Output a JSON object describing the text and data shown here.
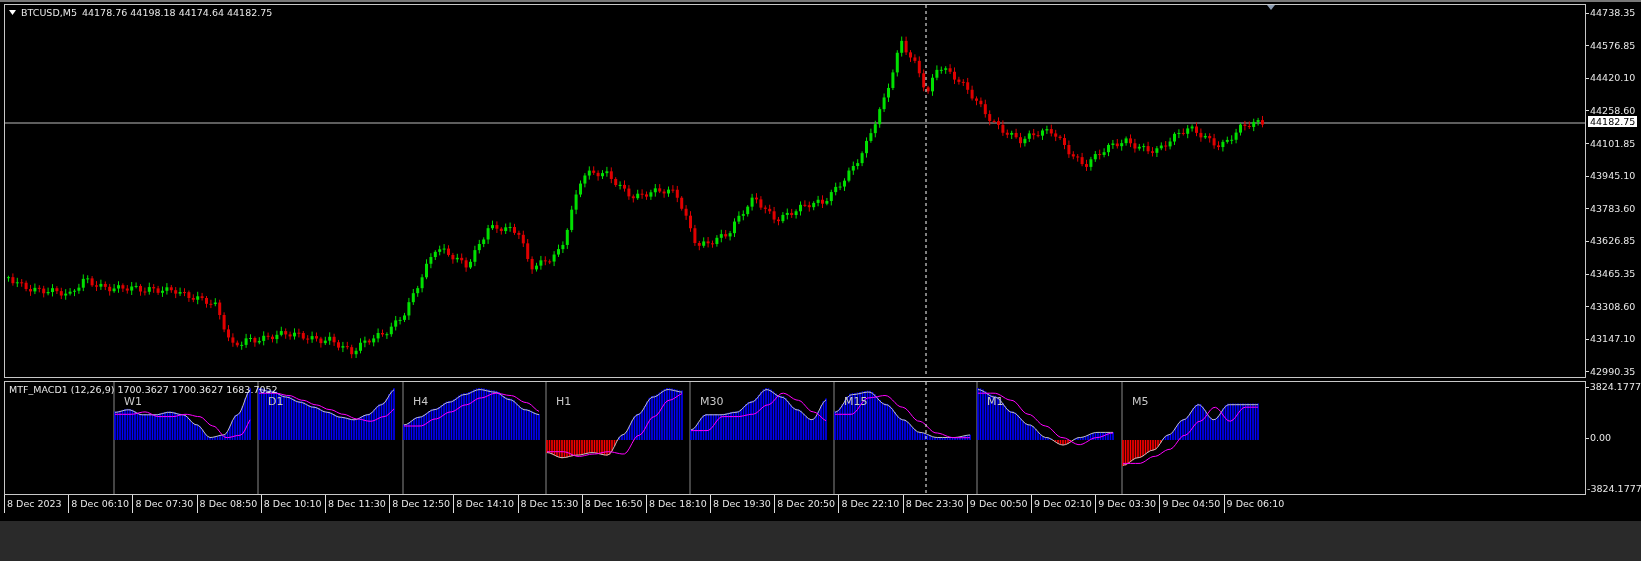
{
  "main_chart": {
    "symbol": "BTCUSD,M5",
    "ohlc": "44178.76 44198.18 44174.64 44182.75",
    "current_price": "44182.75",
    "price_axis": [
      "44738.35",
      "44576.85",
      "44420.10",
      "44258.60",
      "44101.85",
      "43945.10",
      "43783.60",
      "43626.85",
      "43465.35",
      "43308.60",
      "43147.10",
      "42990.35"
    ]
  },
  "indicator": {
    "legend": "MTF_MACD1 (12,26,9) 1700.3627 1700.3627 1683.7052",
    "timeframes": [
      "W1",
      "D1",
      "H4",
      "H1",
      "M30",
      "M15",
      "M1",
      "M5"
    ],
    "axis": [
      "3824.1777",
      "0.00",
      "-3824.1777"
    ]
  },
  "time_axis": [
    "8 Dec 2023",
    "8 Dec 06:10",
    "8 Dec 07:30",
    "8 Dec 08:50",
    "8 Dec 10:10",
    "8 Dec 11:30",
    "8 Dec 12:50",
    "8 Dec 14:10",
    "8 Dec 15:30",
    "8 Dec 16:50",
    "8 Dec 18:10",
    "8 Dec 19:30",
    "8 Dec 20:50",
    "8 Dec 22:10",
    "8 Dec 23:30",
    "9 Dec 00:50",
    "9 Dec 02:10",
    "9 Dec 03:30",
    "9 Dec 04:50",
    "9 Dec 06:10"
  ]
}
